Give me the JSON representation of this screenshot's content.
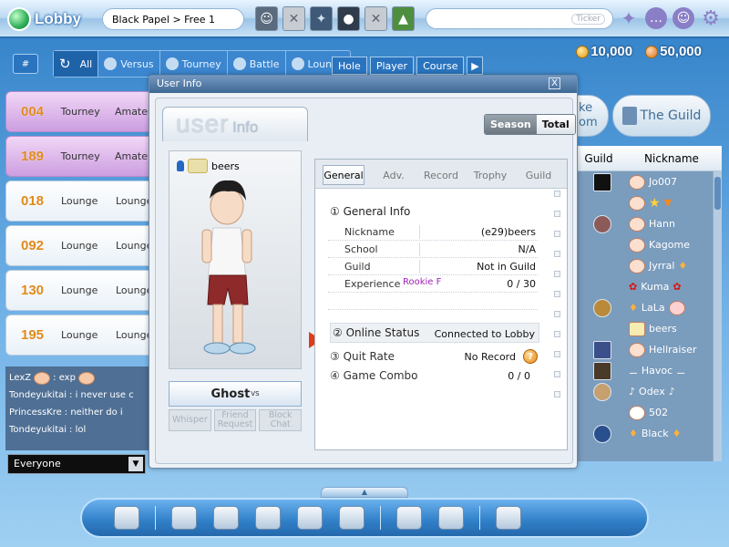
{
  "topbar": {
    "app_title": "Lobby",
    "channel": "Black Papel > Free 1",
    "ticker_label": "Ticker",
    "top_icons": [
      "avatar-thumb-icon",
      "close-x-icon",
      "item-icon",
      "ball-icon",
      "close-x-icon",
      "tree-icon"
    ],
    "right_icons": [
      "sparkle-icon",
      "chat-bubble-icon",
      "face-icon",
      "gear-icon"
    ]
  },
  "filters": {
    "hash_label": "#",
    "tabs": [
      {
        "label": "All",
        "icon": "refresh-icon"
      },
      {
        "label": "Versus",
        "icon": "versus-icon"
      },
      {
        "label": "Tourney",
        "icon": "tourney-icon"
      },
      {
        "label": "Battle",
        "icon": "battle-icon"
      },
      {
        "label": "Lounge",
        "icon": "lounge-icon"
      }
    ],
    "categories": [
      "Hole",
      "Player",
      "Course"
    ],
    "next_arrow": "▶"
  },
  "currency": {
    "points": "10,000",
    "cookies": "50,000"
  },
  "rooms": [
    {
      "num": "004",
      "type": "Tourney",
      "mode": "Amateu",
      "purple": true
    },
    {
      "num": "189",
      "type": "Tourney",
      "mode": "Amateu",
      "purple": true
    },
    {
      "num": "018",
      "type": "Lounge",
      "mode": "Lounge",
      "purple": false
    },
    {
      "num": "092",
      "type": "Lounge",
      "mode": "Lounge",
      "purple": false
    },
    {
      "num": "130",
      "type": "Lounge",
      "mode": "Lounge",
      "purple": false
    },
    {
      "num": "195",
      "type": "Lounge",
      "mode": "Lounge",
      "purple": false
    }
  ],
  "chat": {
    "lines": [
      {
        "user": "LexZ",
        "text": ": exp"
      },
      {
        "user": "Tondeyukitai",
        "text": ": i never use c"
      },
      {
        "user": "PrincessKre",
        "text": ": neither do i"
      },
      {
        "user": "Tondeyukitai",
        "text": ": lol"
      }
    ],
    "channel_select": "Everyone"
  },
  "guild_panel": {
    "partial_tab": "ke\nom",
    "guild_tab": "The Guild",
    "col_guild": "Guild",
    "col_nickname": "Nickname",
    "players": [
      "Jo007",
      "",
      "Hann",
      "Kagome",
      "Jyrral",
      "Kuma",
      "LaLa",
      "beers",
      "Hellraiser",
      "Havoc",
      "Odex",
      "502",
      "Black"
    ]
  },
  "dialog": {
    "title": "User Info",
    "close": "X",
    "header_big": "user",
    "header_small": "Info",
    "season_label": "Season",
    "total_label": "Total",
    "avatar_name": "beers",
    "ghost_label": "Ghost",
    "ghost_sup": "VS",
    "actions": [
      "Whisper",
      "Friend Request",
      "Block Chat"
    ],
    "tabs": [
      "General",
      "Adv.",
      "Record",
      "Trophy",
      "Guild"
    ],
    "general_info": {
      "section": "① General Info",
      "rows": [
        {
          "label": "Nickname",
          "value": "(e29)beers"
        },
        {
          "label": "School",
          "value": "N/A"
        },
        {
          "label": "Guild",
          "value": "Not in Guild"
        },
        {
          "label": "Experience",
          "tag": "Rookie F",
          "value": "0 / 30"
        }
      ]
    },
    "online_status": {
      "label": "② Online Status",
      "value": "Connected to Lobby"
    },
    "quit_rate": {
      "label": "③ Quit Rate",
      "value": "No Record"
    },
    "game_combo": {
      "label": "④ Game Combo",
      "value": "0 / 0"
    }
  },
  "dock": {
    "notch": "▲",
    "items": [
      "music-icon",
      "shop-icon",
      "gift-icon",
      "cards-icon",
      "house-icon",
      "puzzle-icon",
      "home-icon",
      "transfer-icon",
      "settings-face-icon"
    ]
  }
}
